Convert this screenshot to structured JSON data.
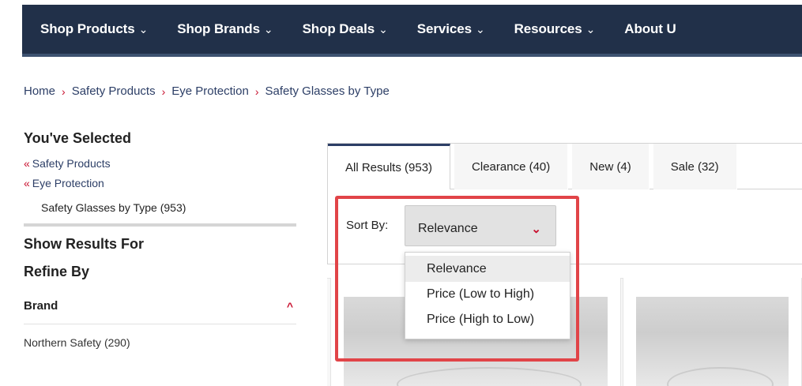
{
  "nav": {
    "items": [
      {
        "label": "Shop Products",
        "chev": "⌄"
      },
      {
        "label": "Shop Brands",
        "chev": "⌄"
      },
      {
        "label": "Shop Deals",
        "chev": "⌄"
      },
      {
        "label": "Services",
        "chev": "⌄"
      },
      {
        "label": "Resources",
        "chev": "⌄"
      },
      {
        "label": "About U",
        "chev": ""
      }
    ]
  },
  "breadcrumb": {
    "items": [
      "Home",
      "Safety Products",
      "Eye Protection",
      "Safety Glasses by Type"
    ],
    "separator": "›"
  },
  "sidebar": {
    "selected_title": "You've Selected",
    "selected_links": [
      "Safety Products",
      "Eye Protection"
    ],
    "link_marker": "«",
    "current": "Safety Glasses by Type (953)",
    "show_results_for": "Show Results For",
    "refine_by": "Refine By",
    "brand_label": "Brand",
    "brand_chevron": "^",
    "brand_options": [
      "Northern Safety (290)"
    ]
  },
  "tabs": [
    {
      "label": "All Results (953)",
      "active": true
    },
    {
      "label": "Clearance (40)",
      "active": false
    },
    {
      "label": "New (4)",
      "active": false
    },
    {
      "label": "Sale (32)",
      "active": false
    }
  ],
  "sort": {
    "label": "Sort By:",
    "value": "Relevance",
    "chevron": "⌄",
    "options": [
      "Relevance",
      "Price (Low to High)",
      "Price (High to Low)"
    ]
  },
  "colors": {
    "nav_bg": "#213049",
    "accent_red": "#c8102e",
    "link_blue": "#2c3e66",
    "highlight": "#e14448"
  }
}
